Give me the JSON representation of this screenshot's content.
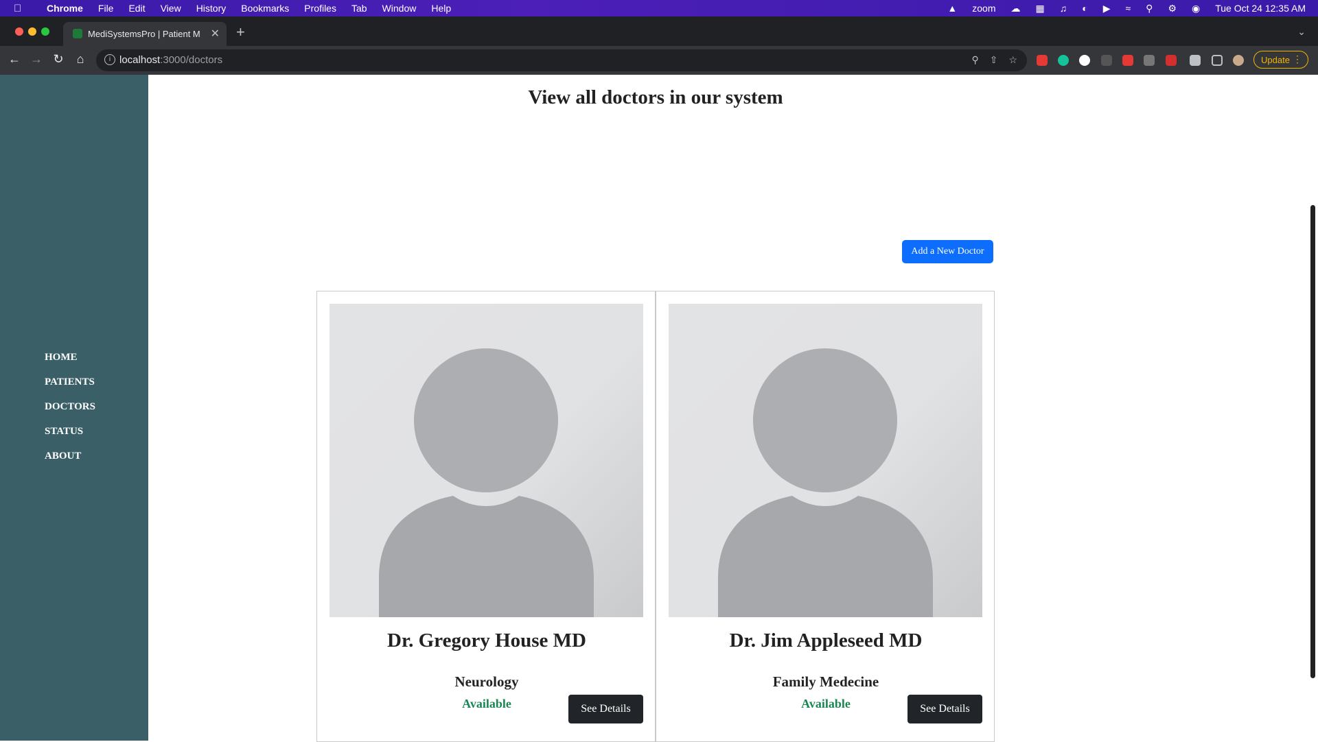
{
  "os_menubar": {
    "app_name": "Chrome",
    "menus": [
      "File",
      "Edit",
      "View",
      "History",
      "Bookmarks",
      "Profiles",
      "Tab",
      "Window",
      "Help"
    ],
    "status_text": "zoom",
    "clock": "Tue Oct 24  12:35 AM"
  },
  "browser": {
    "tab_title": "MediSystemsPro | Patient Man",
    "url_host": "localhost",
    "url_path": ":3000/doctors",
    "update_label": "Update"
  },
  "sidebar": {
    "items": [
      {
        "label": "HOME"
      },
      {
        "label": "PATIENTS"
      },
      {
        "label": "DOCTORS"
      },
      {
        "label": "STATUS"
      },
      {
        "label": "ABOUT"
      }
    ]
  },
  "main": {
    "heading": "View all doctors in our system",
    "add_button_label": "Add a New Doctor",
    "doctors": [
      {
        "name": "Dr. Gregory House MD",
        "specialty": "Neurology",
        "status": "Available",
        "details_label": "See Details"
      },
      {
        "name": "Dr. Jim Appleseed MD",
        "specialty": "Family Medecine",
        "status": "Available",
        "details_label": "See Details"
      }
    ]
  },
  "colors": {
    "sidebar_bg": "#3b5f66",
    "primary_button": "#0d6efd",
    "dark_button": "#212529",
    "status_available": "#198754"
  }
}
